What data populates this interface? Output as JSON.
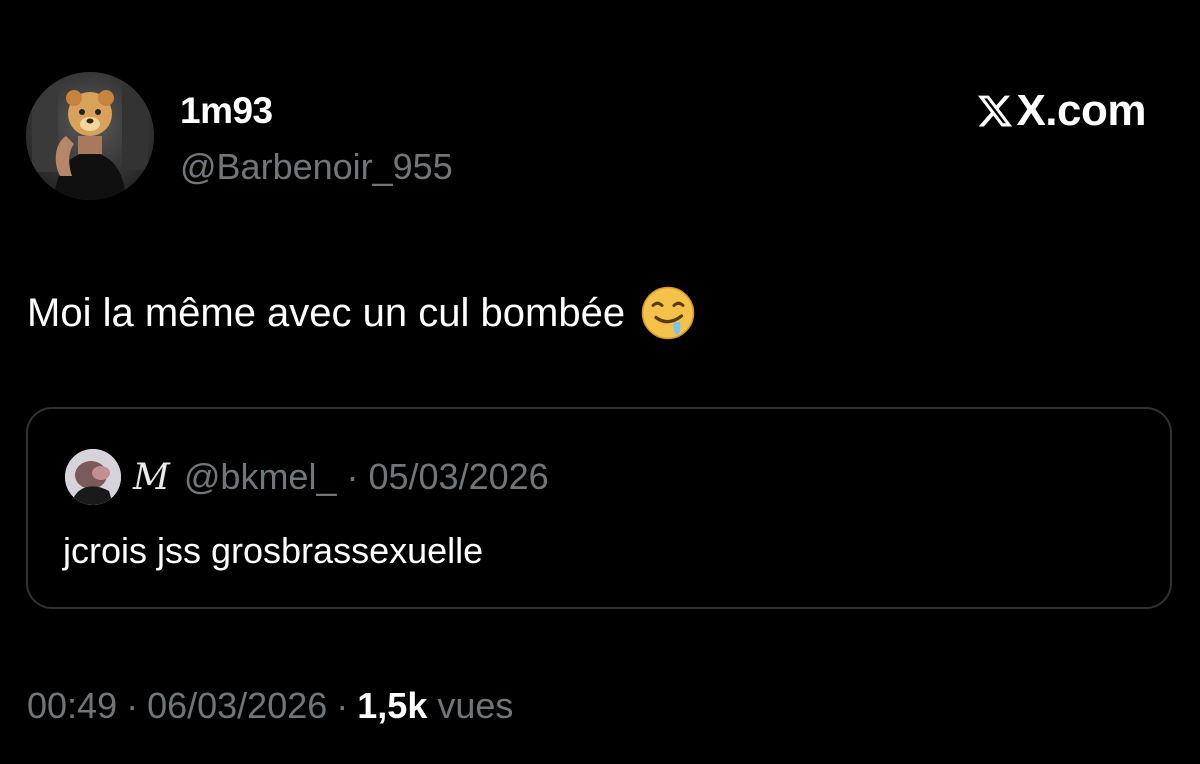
{
  "author": {
    "display_name": "1m93",
    "handle": "@Barbenoir_955",
    "avatar_icon": "profile-photo-with-emoji-mask"
  },
  "brand": {
    "text": "X.com",
    "icon": "x-logo-icon"
  },
  "tweet": {
    "text": "Moi la même avec un cul bombée",
    "emoji": "drooling-face"
  },
  "quote": {
    "display_name": "M",
    "handle": "@bkmel_",
    "separator": "·",
    "date": "05/03/2026",
    "text": "jcrois jss grosbrassexuelle"
  },
  "footer": {
    "time": "00:49",
    "separator": "·",
    "date": "06/03/2026",
    "views_count": "1,5k",
    "views_label": "vues"
  },
  "colors": {
    "background": "#000000",
    "primary_text": "#ffffff",
    "secondary_text": "#71767b",
    "border": "#2f3336"
  }
}
